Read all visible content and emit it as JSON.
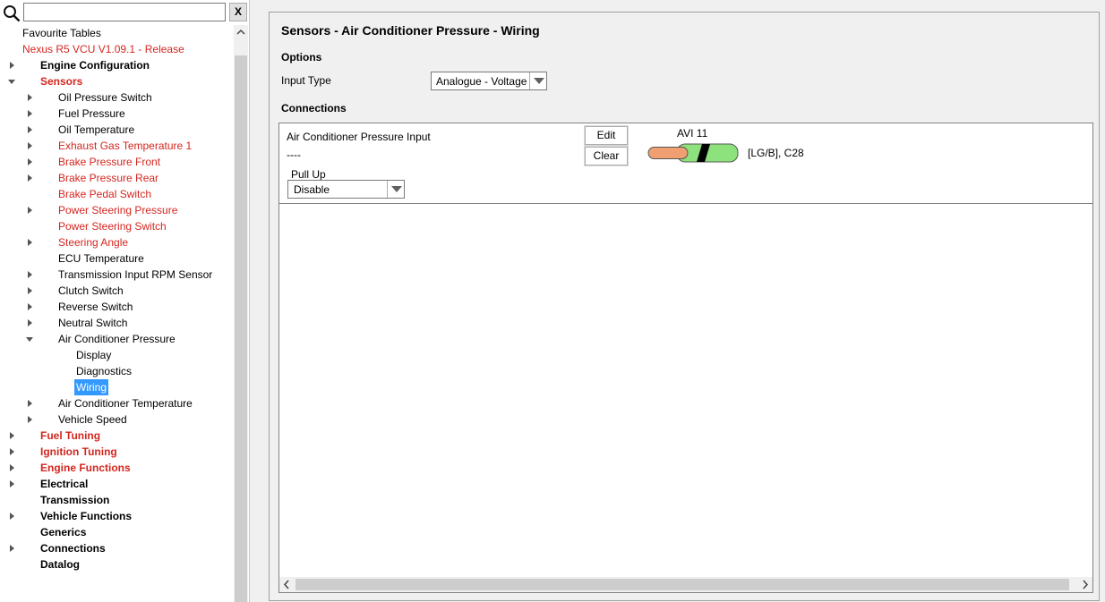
{
  "search": {
    "placeholder": "",
    "clear_label": "X"
  },
  "tree": [
    {
      "label": "Favourite Tables",
      "level": 0,
      "toggle": "none",
      "style": ""
    },
    {
      "label": "Nexus R5 VCU V1.09.1 - Release",
      "level": 0,
      "toggle": "open",
      "style": "red"
    },
    {
      "label": "Engine Configuration",
      "level": 1,
      "toggle": "closed",
      "style": "bold"
    },
    {
      "label": "Sensors",
      "level": 1,
      "toggle": "open",
      "style": "bold red"
    },
    {
      "label": "Oil Pressure Switch",
      "level": 2,
      "toggle": "closed",
      "style": ""
    },
    {
      "label": "Fuel Pressure",
      "level": 2,
      "toggle": "closed",
      "style": ""
    },
    {
      "label": "Oil Temperature",
      "level": 2,
      "toggle": "closed",
      "style": ""
    },
    {
      "label": "Exhaust Gas Temperature 1",
      "level": 2,
      "toggle": "closed",
      "style": "red"
    },
    {
      "label": "Brake Pressure Front",
      "level": 2,
      "toggle": "closed",
      "style": "red"
    },
    {
      "label": "Brake Pressure Rear",
      "level": 2,
      "toggle": "closed",
      "style": "red"
    },
    {
      "label": "Brake Pedal Switch",
      "level": 2,
      "toggle": "none",
      "style": "red"
    },
    {
      "label": "Power Steering Pressure",
      "level": 2,
      "toggle": "closed",
      "style": "red"
    },
    {
      "label": "Power Steering Switch",
      "level": 2,
      "toggle": "none",
      "style": "red"
    },
    {
      "label": "Steering Angle",
      "level": 2,
      "toggle": "closed",
      "style": "red"
    },
    {
      "label": "ECU Temperature",
      "level": 2,
      "toggle": "none",
      "style": ""
    },
    {
      "label": "Transmission Input RPM Sensor",
      "level": 2,
      "toggle": "closed",
      "style": ""
    },
    {
      "label": "Clutch Switch",
      "level": 2,
      "toggle": "closed",
      "style": ""
    },
    {
      "label": "Reverse Switch",
      "level": 2,
      "toggle": "closed",
      "style": ""
    },
    {
      "label": "Neutral Switch",
      "level": 2,
      "toggle": "closed",
      "style": ""
    },
    {
      "label": "Air Conditioner Pressure",
      "level": 2,
      "toggle": "open",
      "style": ""
    },
    {
      "label": "Display",
      "level": 3,
      "toggle": "none",
      "style": ""
    },
    {
      "label": "Diagnostics",
      "level": 3,
      "toggle": "none",
      "style": ""
    },
    {
      "label": "Wiring",
      "level": 3,
      "toggle": "none",
      "style": "sel"
    },
    {
      "label": "Air Conditioner Temperature",
      "level": 2,
      "toggle": "closed",
      "style": ""
    },
    {
      "label": "Vehicle Speed",
      "level": 2,
      "toggle": "closed",
      "style": ""
    },
    {
      "label": "Fuel Tuning",
      "level": 1,
      "toggle": "closed",
      "style": "bold red"
    },
    {
      "label": "Ignition Tuning",
      "level": 1,
      "toggle": "closed",
      "style": "bold red"
    },
    {
      "label": "Engine Functions",
      "level": 1,
      "toggle": "closed",
      "style": "bold red"
    },
    {
      "label": "Electrical",
      "level": 1,
      "toggle": "closed",
      "style": "bold"
    },
    {
      "label": "Transmission",
      "level": 1,
      "toggle": "none",
      "style": "bold"
    },
    {
      "label": "Vehicle Functions",
      "level": 1,
      "toggle": "closed",
      "style": "bold"
    },
    {
      "label": "Generics",
      "level": 1,
      "toggle": "none",
      "style": "bold"
    },
    {
      "label": "Connections",
      "level": 1,
      "toggle": "closed",
      "style": "bold"
    },
    {
      "label": "Datalog",
      "level": 1,
      "toggle": "none",
      "style": "bold"
    }
  ],
  "page": {
    "title": "Sensors - Air Conditioner Pressure - Wiring",
    "options_title": "Options",
    "input_type_label": "Input Type",
    "input_type_value": "Analogue - Voltage",
    "connections_title": "Connections"
  },
  "connection": {
    "name": "Air Conditioner Pressure Input",
    "value": "----",
    "edit_label": "Edit",
    "clear_label": "Clear",
    "pin": "AVI 11",
    "wire": "[LG/B], C28",
    "pullup_label": "Pull Up",
    "pullup_value": "Disable",
    "wire_colors": {
      "insulation": "#8ee27e",
      "stripe": "#000000",
      "core": "#f0a070"
    }
  },
  "colors": {
    "selection": "#3399ff",
    "highlight_text": "#d4261f"
  }
}
